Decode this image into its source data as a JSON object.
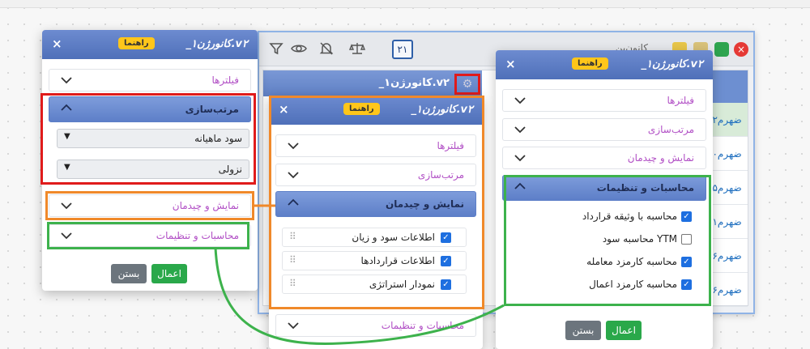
{
  "app": {
    "toolbar_badge": "۲۱",
    "title": "کانون‌ین",
    "list_title": "_کانورژن۱.v۲",
    "right_cells": [
      "ضهرم۱۲",
      "ضهرم۲۰",
      "ضهرم۱۵",
      "ضهرم۲۱",
      "ضهرم۱۶",
      "ضهرم۱۶"
    ]
  },
  "panel_left": {
    "title": "_کانورژن۱.v۲",
    "help": "راهنما",
    "sections": {
      "filters": "فیلترها",
      "sort": "مرتب‌سازی",
      "display": "نمایش و چیدمان",
      "calc": "محاسبات و تنظیمات"
    },
    "sort_field": "سود ماهیانه",
    "sort_order": "نزولی",
    "apply": "اعمال",
    "close": "بستن"
  },
  "panel_mid": {
    "title": "_کانورژن۱.v۲",
    "help": "راهنما",
    "sections": {
      "filters": "فیلترها",
      "sort": "مرتب‌سازی",
      "display": "نمایش و چیدمان",
      "calc": "محاسبات و تنظیمات"
    },
    "items": [
      "اطلاعات سود و زیان",
      "اطلاعات قراردادها",
      "نمودار استراتژی"
    ]
  },
  "panel_right": {
    "title": "_کانورژن۱.v۲",
    "help": "راهنما",
    "sections": {
      "filters": "فیلترها",
      "sort": "مرتب‌سازی",
      "display": "نمایش و چیدمان",
      "calc": "محاسبات و تنظیمات"
    },
    "options": [
      {
        "label": "محاسبه با وثیقه قرارداد",
        "checked": true
      },
      {
        "label": "محاسبه سود YTM",
        "checked": false
      },
      {
        "label": "محاسبه کارمزد معامله",
        "checked": true
      },
      {
        "label": "محاسبه کارمزد اعمال",
        "checked": true
      }
    ],
    "apply": "اعمال",
    "close": "بستن"
  },
  "colors": {
    "highlight_red": "#e01b1b",
    "highlight_orange": "#f0892a",
    "highlight_green": "#3db24c",
    "header_blue": "#5f80c4",
    "apply_green": "#2aa84a"
  }
}
